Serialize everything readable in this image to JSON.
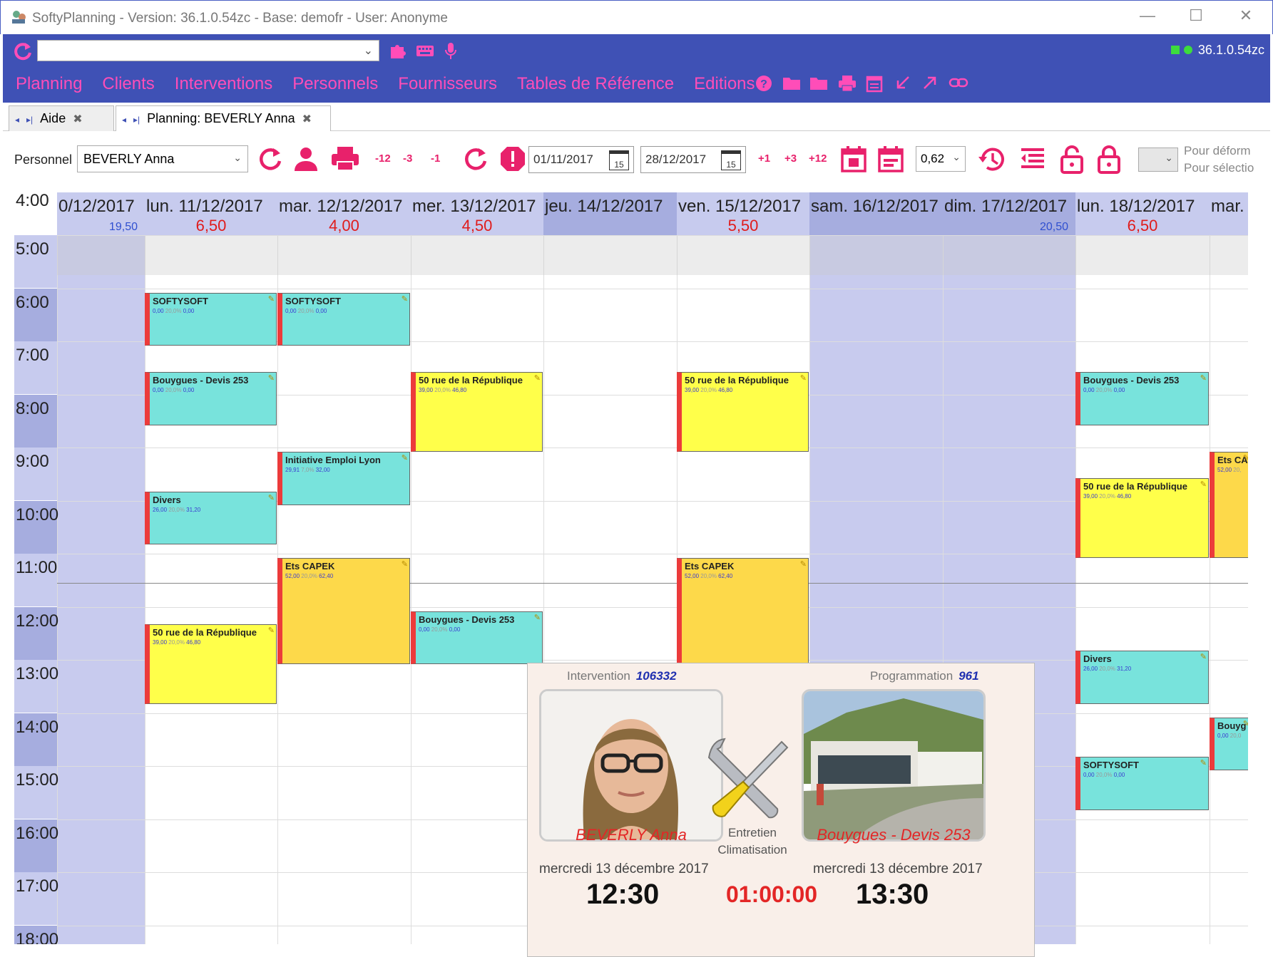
{
  "window": {
    "title": "SoftyPlanning - Version: 36.1.0.54zc - Base: demofr - User: Anonyme",
    "minimize": "—",
    "maximize": "☐",
    "close": "✕"
  },
  "toolbar": {
    "version": "36.1.0.54zc",
    "command_value": ""
  },
  "menu": [
    "Planning",
    "Clients",
    "Interventions",
    "Personnels",
    "Fournisseurs",
    "Tables de Référence",
    "Editions"
  ],
  "tabs": [
    {
      "label": "Aide"
    },
    {
      "label": "Planning: BEVERLY Anna"
    }
  ],
  "filter": {
    "personnel_label": "Personnel",
    "personnel_value": "BEVERLY Anna",
    "minus12": "-12",
    "minus3": "-3",
    "minus1": "-1",
    "date_from": "01/11/2017",
    "date_to": "28/12/2017",
    "cal_day": "15",
    "plus1": "+1",
    "plus3": "+3",
    "plus12": "+12",
    "zoom": "0,62",
    "hint1": "Pour déform",
    "hint2": "Pour sélectio"
  },
  "planning": {
    "days": [
      {
        "date": "0/12/2017",
        "total": "",
        "total_blue": "19,50",
        "weekend": true
      },
      {
        "date": "lun. 11/12/2017",
        "total": "6,50",
        "total_blue": "",
        "weekend": false
      },
      {
        "date": "mar. 12/12/2017",
        "total": "4,00",
        "total_blue": "",
        "weekend": false
      },
      {
        "date": "mer. 13/12/2017",
        "total": "4,50",
        "total_blue": "",
        "weekend": false
      },
      {
        "date": "jeu. 14/12/2017",
        "total": "",
        "total_blue": "",
        "weekend": false
      },
      {
        "date": "ven. 15/12/2017",
        "total": "5,50",
        "total_blue": "",
        "weekend": false
      },
      {
        "date": "sam. 16/12/2017",
        "total": "",
        "total_blue": "",
        "weekend": true
      },
      {
        "date": "dim. 17/12/2017",
        "total": "",
        "total_blue": "20,50",
        "weekend": true
      },
      {
        "date": "lun. 18/12/2017",
        "total": "6,50",
        "total_blue": "",
        "weekend": false
      },
      {
        "date": "mar.",
        "total": "",
        "total_blue": "",
        "weekend": false
      }
    ],
    "hours": [
      "4:00",
      "5:00",
      "6:00",
      "7:00",
      "8:00",
      "9:00",
      "10:00",
      "11:00",
      "12:00",
      "13:00",
      "14:00",
      "15:00",
      "16:00",
      "17:00",
      "18:00"
    ],
    "appointments": [
      {
        "day": 1,
        "start": 6.0,
        "end": 7.0,
        "name": "SOFTYSOFT",
        "v1": "0,00",
        "pct": "20,0%",
        "v2": "0,00",
        "color": "cyan"
      },
      {
        "day": 1,
        "start": 7.5,
        "end": 8.5,
        "name": "Bouygues - Devis 253",
        "v1": "0,00",
        "pct": "20,0%",
        "v2": "0,00",
        "color": "cyan"
      },
      {
        "day": 1,
        "start": 9.75,
        "end": 10.75,
        "name": "Divers",
        "v1": "26,00",
        "pct": "20,0%",
        "v2": "31,20",
        "color": "cyan"
      },
      {
        "day": 1,
        "start": 12.25,
        "end": 13.75,
        "name": "50 rue de la République",
        "v1": "39,00",
        "pct": "20,0%",
        "v2": "46,80",
        "color": "yellow"
      },
      {
        "day": 2,
        "start": 6.0,
        "end": 7.0,
        "name": "SOFTYSOFT",
        "v1": "0,00",
        "pct": "20,0%",
        "v2": "0,00",
        "color": "cyan"
      },
      {
        "day": 2,
        "start": 9.0,
        "end": 10.0,
        "name": "Initiative Emploi Lyon",
        "v1": "29,91",
        "pct": "7,0%",
        "v2": "32,00",
        "color": "cyan"
      },
      {
        "day": 2,
        "start": 11.0,
        "end": 13.0,
        "name": "Ets CAPEK",
        "v1": "52,00",
        "pct": "20,0%",
        "v2": "62,40",
        "color": "gold"
      },
      {
        "day": 3,
        "start": 7.5,
        "end": 9.0,
        "name": "50 rue de la République",
        "v1": "39,00",
        "pct": "20,0%",
        "v2": "46,80",
        "color": "yellow"
      },
      {
        "day": 3,
        "start": 12.0,
        "end": 13.0,
        "name": "Bouygues - Devis 253",
        "v1": "0,00",
        "pct": "20,0%",
        "v2": "0,00",
        "color": "cyan"
      },
      {
        "day": 5,
        "start": 7.5,
        "end": 9.0,
        "name": "50 rue de la République",
        "v1": "39,00",
        "pct": "20,0%",
        "v2": "46,80",
        "color": "yellow"
      },
      {
        "day": 5,
        "start": 11.0,
        "end": 13.0,
        "name": "Ets CAPEK",
        "v1": "52,00",
        "pct": "20,0%",
        "v2": "62,40",
        "color": "gold"
      },
      {
        "day": 8,
        "start": 7.5,
        "end": 8.5,
        "name": "Bouygues - Devis 253",
        "v1": "0,00",
        "pct": "20,0%",
        "v2": "0,00",
        "color": "cyan"
      },
      {
        "day": 8,
        "start": 9.5,
        "end": 11.0,
        "name": "50 rue de la République",
        "v1": "39,00",
        "pct": "20,0%",
        "v2": "46,80",
        "color": "yellow"
      },
      {
        "day": 8,
        "start": 12.75,
        "end": 13.75,
        "name": "Divers",
        "v1": "26,00",
        "pct": "20,0%",
        "v2": "31,20",
        "color": "cyan"
      },
      {
        "day": 8,
        "start": 14.75,
        "end": 15.75,
        "name": "SOFTYSOFT",
        "v1": "0,00",
        "pct": "20,0%",
        "v2": "0,00",
        "color": "cyan"
      },
      {
        "day": 9,
        "start": 9.0,
        "end": 11.0,
        "name": "Ets CA",
        "v1": "52,00",
        "pct": "20,",
        "v2": "",
        "color": "gold"
      },
      {
        "day": 9,
        "start": 14.0,
        "end": 15.0,
        "name": "Bouyg",
        "v1": "0,00",
        "pct": "20,0",
        "v2": "",
        "color": "cyan"
      }
    ]
  },
  "popup": {
    "intervention_label": "Intervention",
    "intervention_no": "106332",
    "programmation_label": "Programmation",
    "programmation_no": "961",
    "person_name": "BEVERLY Anna",
    "client_name": "Bouygues - Devis 253",
    "category_line1": "Entretien",
    "category_line2": "Climatisation",
    "start_date": "mercredi 13 décembre 2017",
    "end_date": "mercredi 13 décembre 2017",
    "start_time": "12:30",
    "duration": "01:00:00",
    "end_time": "13:30"
  },
  "colors": {
    "accent": "#3f51b5",
    "menu_text": "#ff4db8",
    "header": "#c7cbee",
    "weekend": "#a6addf",
    "cyan": "#78e3dc",
    "yellow": "#ffff4a",
    "gold": "#fdd94a"
  }
}
